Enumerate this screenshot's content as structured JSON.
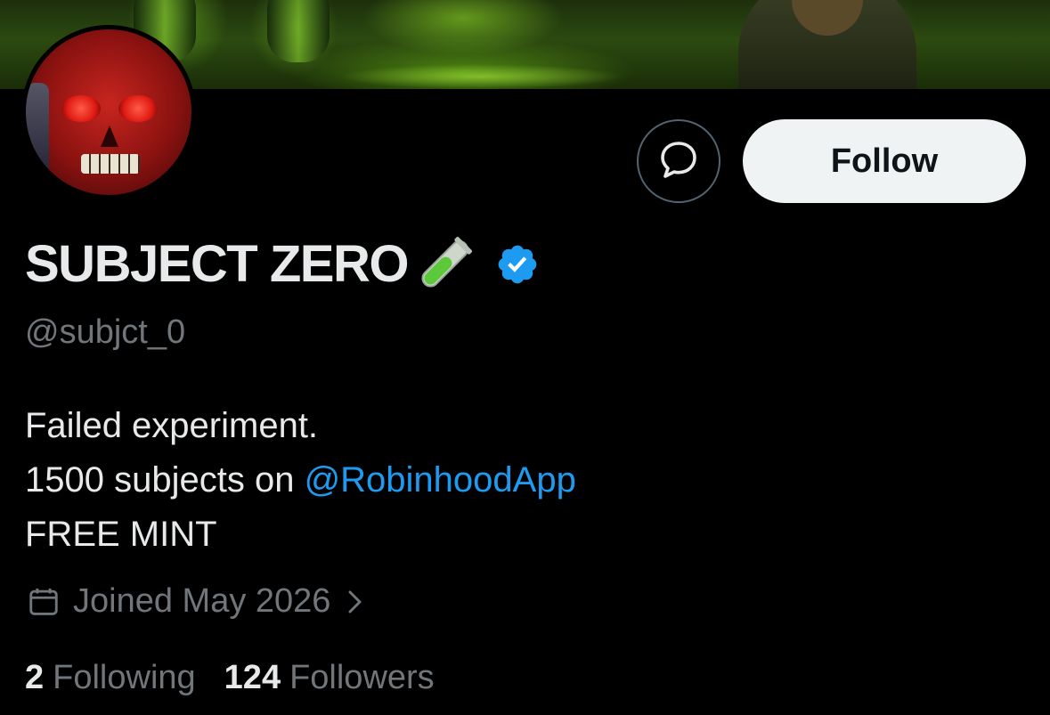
{
  "profile": {
    "display_name": "SUBJECT ZERO",
    "handle": "@subjct_0",
    "bio_line1": "Failed experiment.",
    "bio_line2_prefix": "1500 subjects on ",
    "bio_mention": "@RobinhoodApp",
    "bio_line3": "FREE MINT",
    "joined": "Joined May 2026",
    "following_count": "2",
    "following_label": "Following",
    "followers_count": "124",
    "followers_label": "Followers"
  },
  "actions": {
    "follow_label": "Follow"
  },
  "icons": {
    "message": "message-bubble-icon",
    "verified": "verified-badge-icon",
    "name_emoji": "test-tube-icon",
    "calendar": "calendar-icon",
    "chevron": "chevron-right-icon"
  },
  "colors": {
    "background": "#000000",
    "primary_text": "#e7e9ea",
    "secondary_text": "#71767b",
    "link": "#1d9bf0",
    "verified": "#1d9bf0",
    "follow_button_bg": "#eff3f4",
    "banner_green": "#6fbf1f"
  }
}
